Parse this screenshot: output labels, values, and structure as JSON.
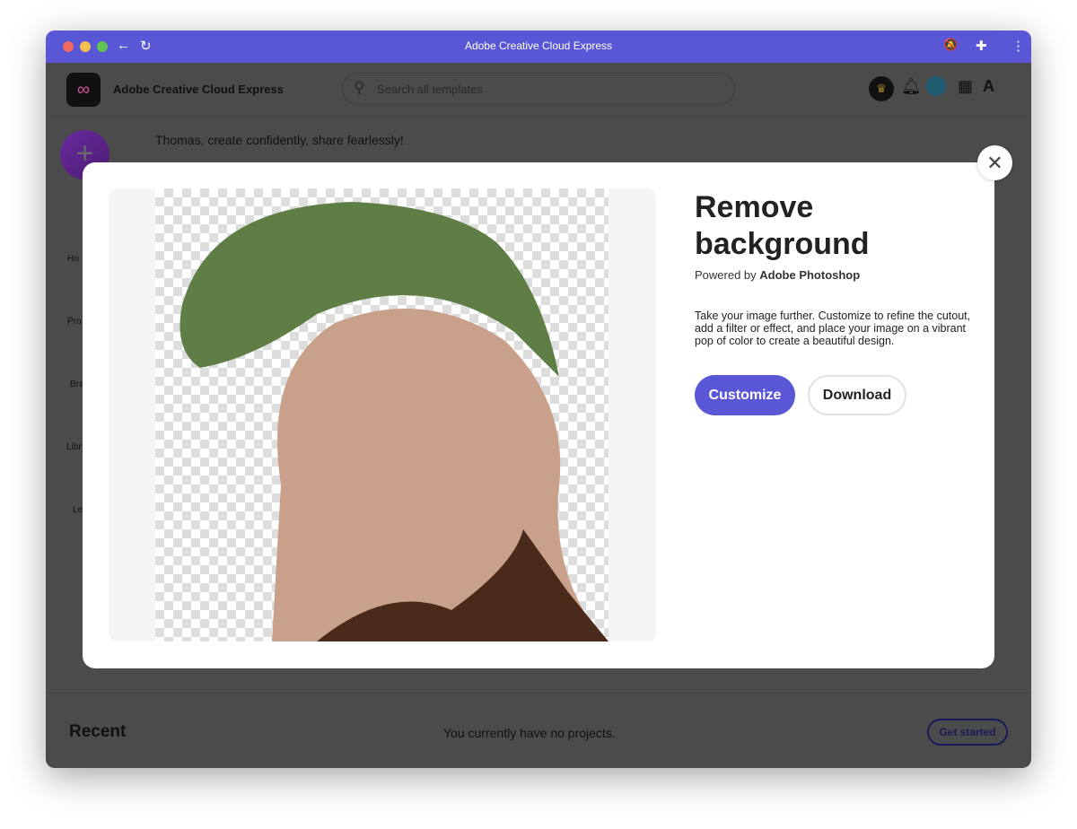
{
  "window": {
    "title": "Adobe Creative Cloud Express"
  },
  "appbar": {
    "name": "Adobe Creative Cloud Express",
    "search_placeholder": "Search all templates"
  },
  "main": {
    "greeting": "Thomas, create confidently, share fearlessly!",
    "sidebar": [
      "Ho",
      "Pro",
      "Bra",
      "Libr",
      "Le"
    ],
    "recent_title": "Recent",
    "no_projects": "You currently have no projects.",
    "get_started": "Get started"
  },
  "modal": {
    "title": "Remove background",
    "powered_prefix": "Powered by ",
    "powered_brand": "Adobe Photoshop",
    "description": "Take your image further. Customize to refine the cutout, add a filter or effect, and place your image on a vibrant pop of color to create a beautiful design.",
    "customize": "Customize",
    "download": "Download"
  },
  "colors": {
    "accent": "#5a57d6"
  }
}
